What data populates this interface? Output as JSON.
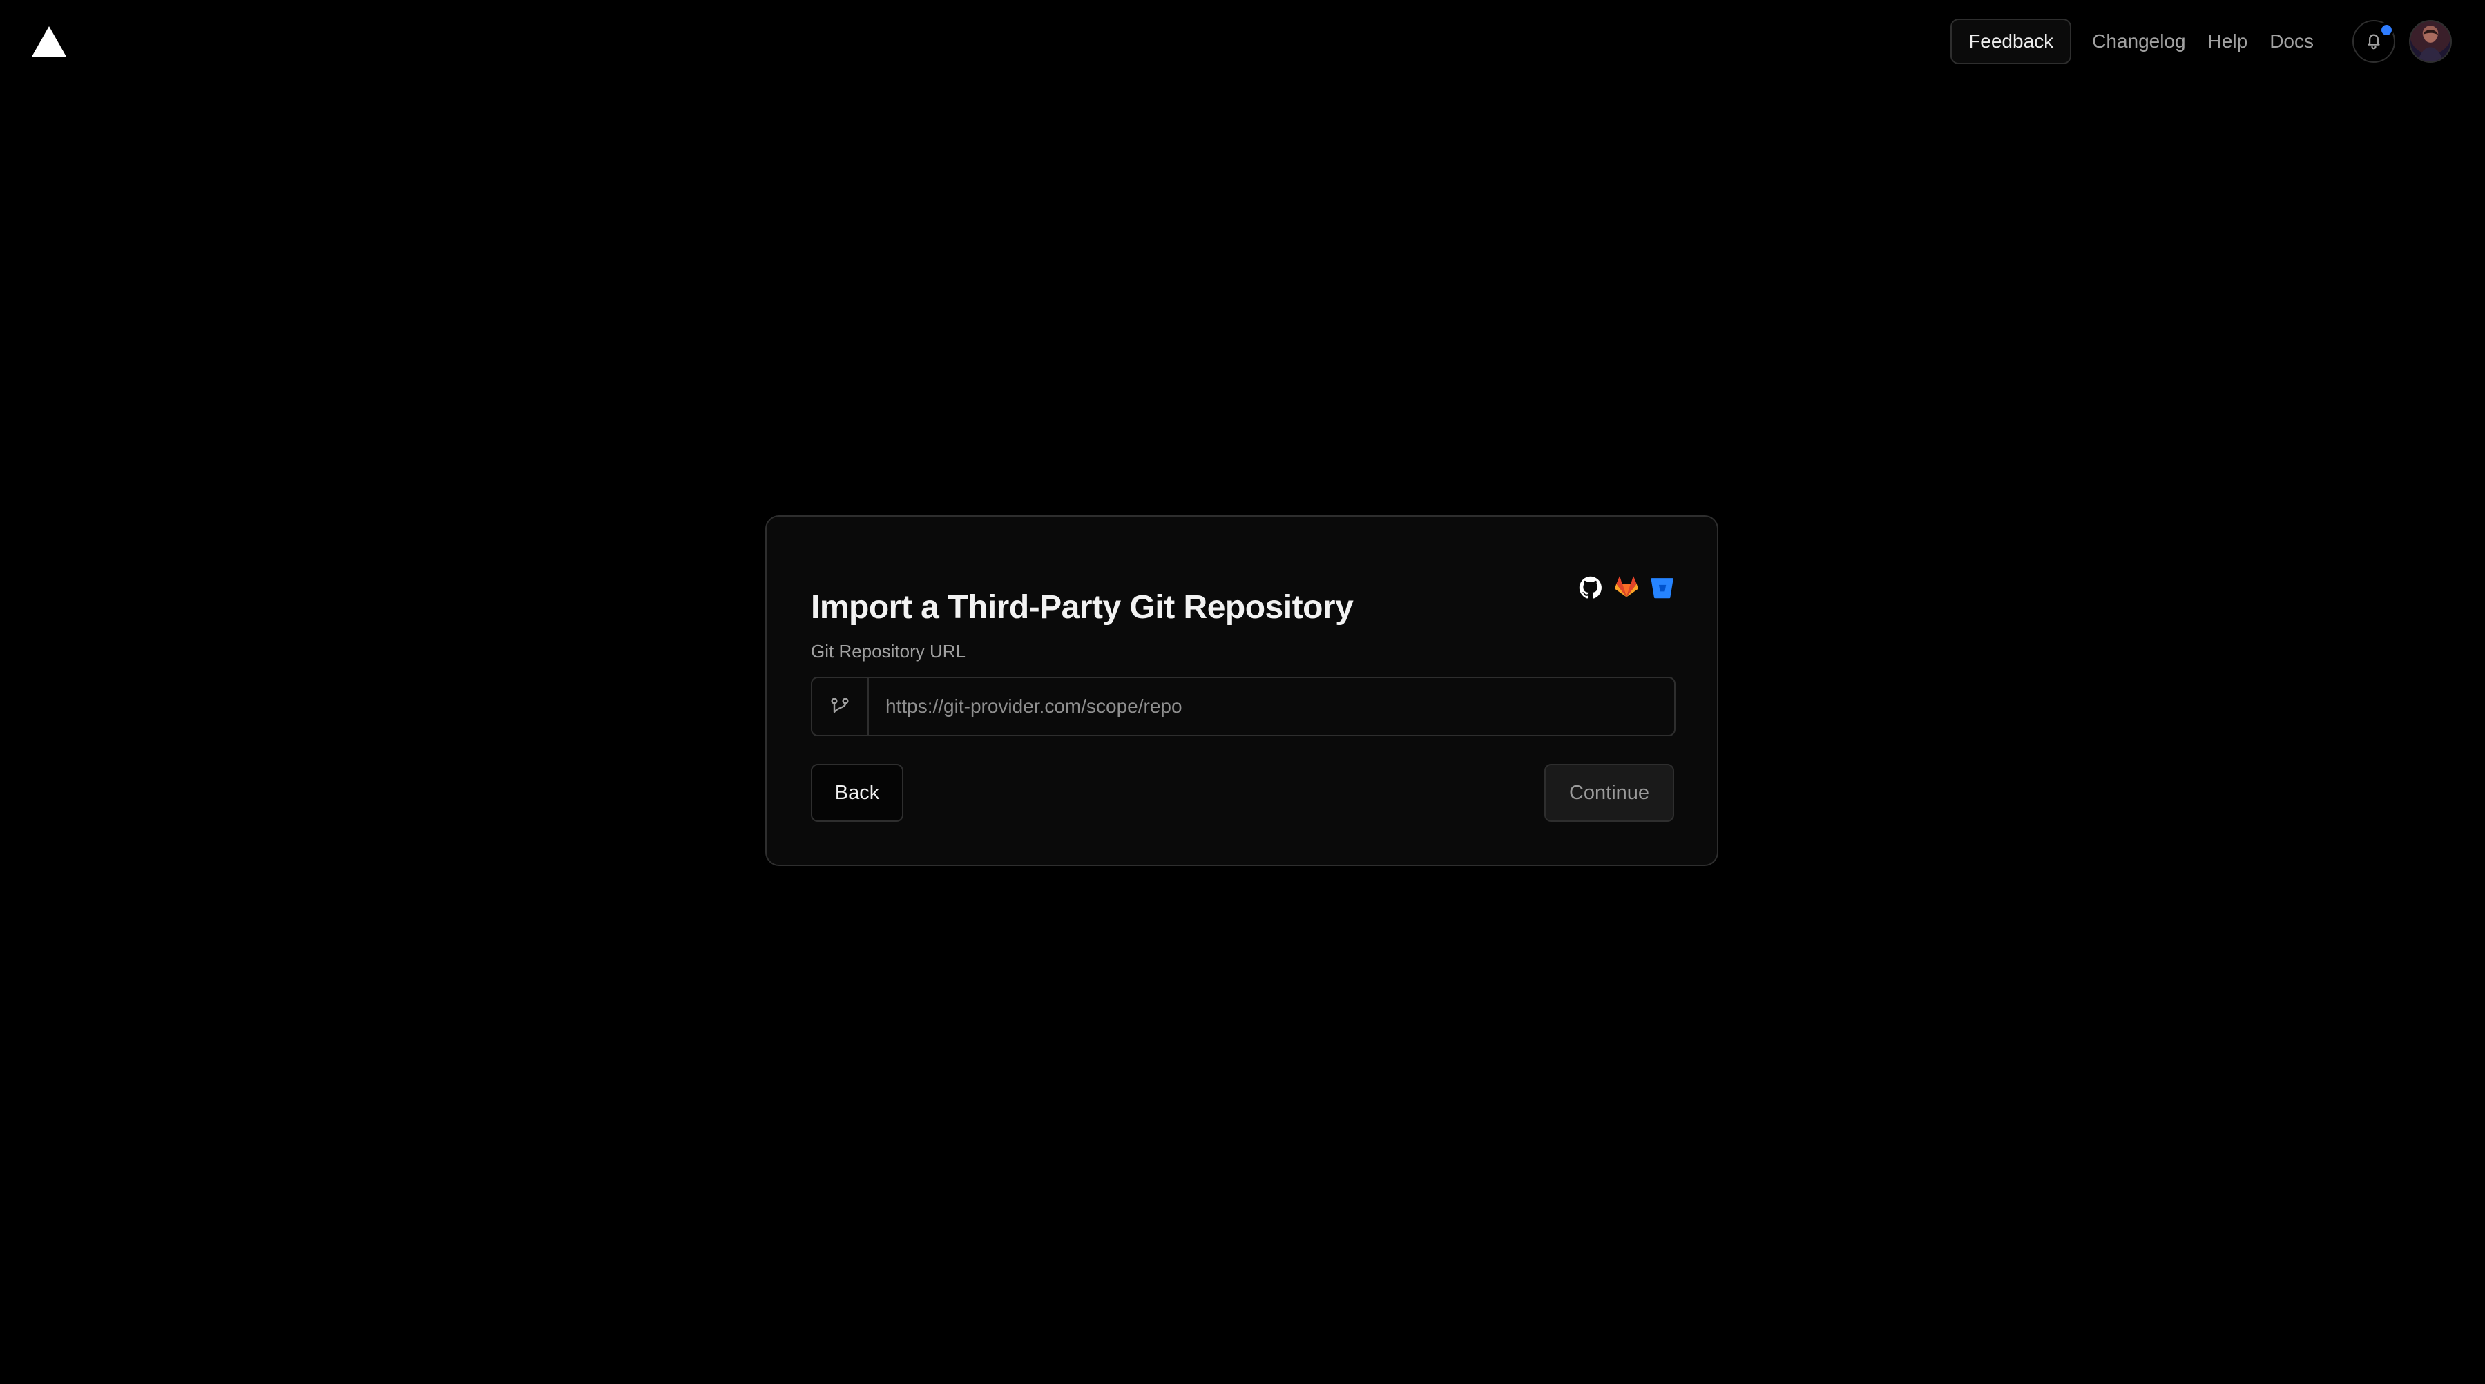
{
  "header": {
    "logo_icon": "vercel-triangle-icon",
    "feedback_label": "Feedback",
    "links": [
      "Changelog",
      "Help",
      "Docs"
    ],
    "notification_icon": "bell-icon",
    "has_unread_notifications": true,
    "accent_color": "#2f7dff"
  },
  "dialog": {
    "title": "Import a Third-Party Git Repository",
    "providers": [
      {
        "name": "GitHub",
        "icon": "github-icon"
      },
      {
        "name": "GitLab",
        "icon": "gitlab-icon"
      },
      {
        "name": "Bitbucket",
        "icon": "bitbucket-icon"
      }
    ],
    "field_label": "Git Repository URL",
    "input": {
      "placeholder": "https://git-provider.com/scope/repo",
      "value": ""
    },
    "back_label": "Back",
    "continue_label": "Continue"
  }
}
